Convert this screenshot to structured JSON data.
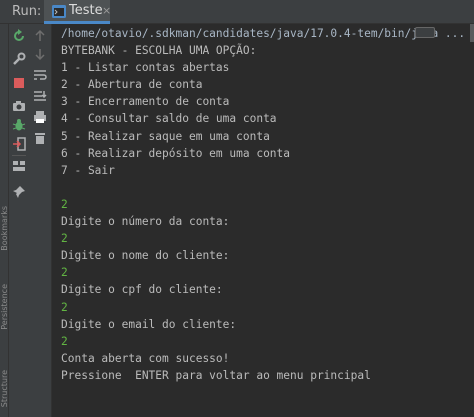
{
  "header": {
    "run_label": "Run:",
    "tab_label": "Teste",
    "tab_close": "×"
  },
  "side_strip": {
    "labels": [
      "Bookmarks",
      "Persistence",
      "Structure"
    ]
  },
  "toolbar": {
    "left": [
      "rerun-icon",
      "wrench-icon",
      "stop-icon",
      "camera-icon",
      "debug-icon",
      "login-icon",
      "layout-icon",
      "pin-icon"
    ],
    "right": [
      "up-icon",
      "down-icon",
      "soft-wrap-icon",
      "scroll-end-icon",
      "print-icon",
      "trash-icon"
    ]
  },
  "colors": {
    "background": "#2b2b2b",
    "panel": "#3c3f41",
    "console_text": "#bbbbbb",
    "input_text": "#62b543",
    "accent": "#4a88c7"
  },
  "console": {
    "command": "/home/otavio/.sdkman/candidates/java/17.0.4-tem/bin/java ...",
    "lines": [
      {
        "text": "BYTEBANK - ESCOLHA UMA OPÇÃO:",
        "type": "out"
      },
      {
        "text": "1 - Listar contas abertas",
        "type": "out"
      },
      {
        "text": "2 - Abertura de conta",
        "type": "out"
      },
      {
        "text": "3 - Encerramento de conta",
        "type": "out"
      },
      {
        "text": "4 - Consultar saldo de uma conta",
        "type": "out"
      },
      {
        "text": "5 - Realizar saque em uma conta",
        "type": "out"
      },
      {
        "text": "6 - Realizar depósito em uma conta",
        "type": "out"
      },
      {
        "text": "7 - Sair",
        "type": "out"
      },
      {
        "text": "",
        "type": "out"
      },
      {
        "text": "2",
        "type": "input"
      },
      {
        "text": "Digite o número da conta:",
        "type": "out"
      },
      {
        "text": "2",
        "type": "input"
      },
      {
        "text": "Digite o nome do cliente:",
        "type": "out"
      },
      {
        "text": "2",
        "type": "input"
      },
      {
        "text": "Digite o cpf do cliente:",
        "type": "out"
      },
      {
        "text": "2",
        "type": "input"
      },
      {
        "text": "Digite o email do cliente:",
        "type": "out"
      },
      {
        "text": "2",
        "type": "input"
      },
      {
        "text": "Conta aberta com sucesso!",
        "type": "out"
      },
      {
        "text": "Pressione  ENTER para voltar ao menu principal",
        "type": "out"
      }
    ]
  }
}
